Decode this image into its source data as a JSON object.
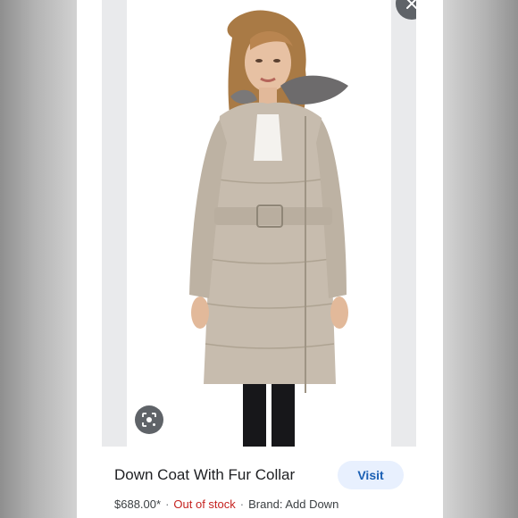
{
  "product": {
    "title": "Down Coat With Fur Collar",
    "price": "$688.00*",
    "stock_status": "Out of stock",
    "brand": "Brand: Add Down",
    "separator": "·"
  },
  "actions": {
    "visit_label": "Visit"
  },
  "icons": {
    "close": "close-icon",
    "lens": "lens-search-icon"
  },
  "colors": {
    "visit_bg": "#e8f0fe",
    "visit_text": "#1a5fb4",
    "stock_text": "#c5221f",
    "icon_button_bg": "#5f6368"
  }
}
